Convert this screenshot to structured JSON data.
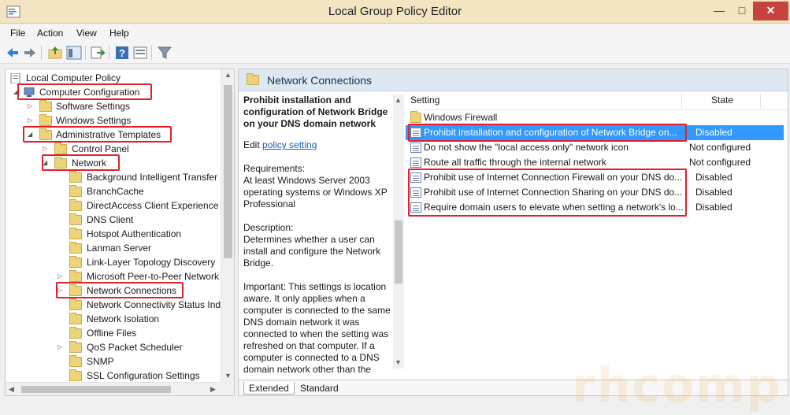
{
  "window": {
    "title": "Local Group Policy Editor",
    "minimize": "—",
    "maximize": "□",
    "close": "✕"
  },
  "menu": [
    "File",
    "Action",
    "View",
    "Help"
  ],
  "toolbar_icons": [
    "back-arrow-icon",
    "forward-arrow-icon",
    "up-folder-icon",
    "show-hide-tree-icon",
    "export-list-icon",
    "help-icon",
    "properties-icon",
    "filter-icon"
  ],
  "tree": {
    "items": [
      {
        "label": "Local Computer Policy"
      },
      {
        "label": "Computer Configuration"
      },
      {
        "label": "Software Settings"
      },
      {
        "label": "Windows Settings"
      },
      {
        "label": "Administrative Templates"
      },
      {
        "label": "Control Panel"
      },
      {
        "label": "Network"
      },
      {
        "label": "Background Intelligent Transfer"
      },
      {
        "label": "BranchCache"
      },
      {
        "label": "DirectAccess Client Experience S"
      },
      {
        "label": "DNS Client"
      },
      {
        "label": "Hotspot Authentication"
      },
      {
        "label": "Lanman Server"
      },
      {
        "label": "Link-Layer Topology Discovery"
      },
      {
        "label": "Microsoft Peer-to-Peer Network"
      },
      {
        "label": "Network Connections"
      },
      {
        "label": "Network Connectivity Status Ind"
      },
      {
        "label": "Network Isolation"
      },
      {
        "label": "Offline Files"
      },
      {
        "label": "QoS Packet Scheduler"
      },
      {
        "label": "SNMP"
      },
      {
        "label": "SSL Configuration Settings"
      }
    ]
  },
  "right": {
    "header": "Network Connections",
    "description": {
      "title": "Prohibit installation and configuration of Network Bridge on your DNS domain network",
      "edit_prefix": "Edit",
      "edit_link": "policy setting",
      "requirements_label": "Requirements:",
      "requirements": "At least Windows Server 2003 operating systems or Windows XP Professional",
      "description_label": "Description:",
      "description": "Determines whether a user can install and configure the Network Bridge.",
      "important": "Important: This settings is location aware. It only applies when a computer is connected to the same DNS domain network it was connected to when the setting was refreshed on that computer. If a computer is connected to a DNS domain network other than the"
    },
    "columns": {
      "setting": "Setting",
      "state": "State"
    },
    "rows": [
      {
        "name": "Windows Firewall",
        "state": "",
        "type": "folder"
      },
      {
        "name": "Prohibit installation and configuration of Network Bridge on...",
        "state": "Disabled",
        "type": "policy"
      },
      {
        "name": "Do not show the \"local access only\" network icon",
        "state": "Not configured",
        "type": "policy"
      },
      {
        "name": "Route all traffic through the internal network",
        "state": "Not configured",
        "type": "policy"
      },
      {
        "name": "Prohibit use of Internet Connection Firewall on your DNS do...",
        "state": "Disabled",
        "type": "policy"
      },
      {
        "name": "Prohibit use of Internet Connection Sharing on your DNS do...",
        "state": "Disabled",
        "type": "policy"
      },
      {
        "name": "Require domain users to elevate when setting a network's lo...",
        "state": "Disabled",
        "type": "policy"
      }
    ],
    "tabs": [
      "Extended",
      "Standard"
    ]
  },
  "watermark": "rhcomp",
  "colors": {
    "selection": "#3399ff",
    "highlight": "#e0202a",
    "titlebar": "#f3e4c2"
  }
}
